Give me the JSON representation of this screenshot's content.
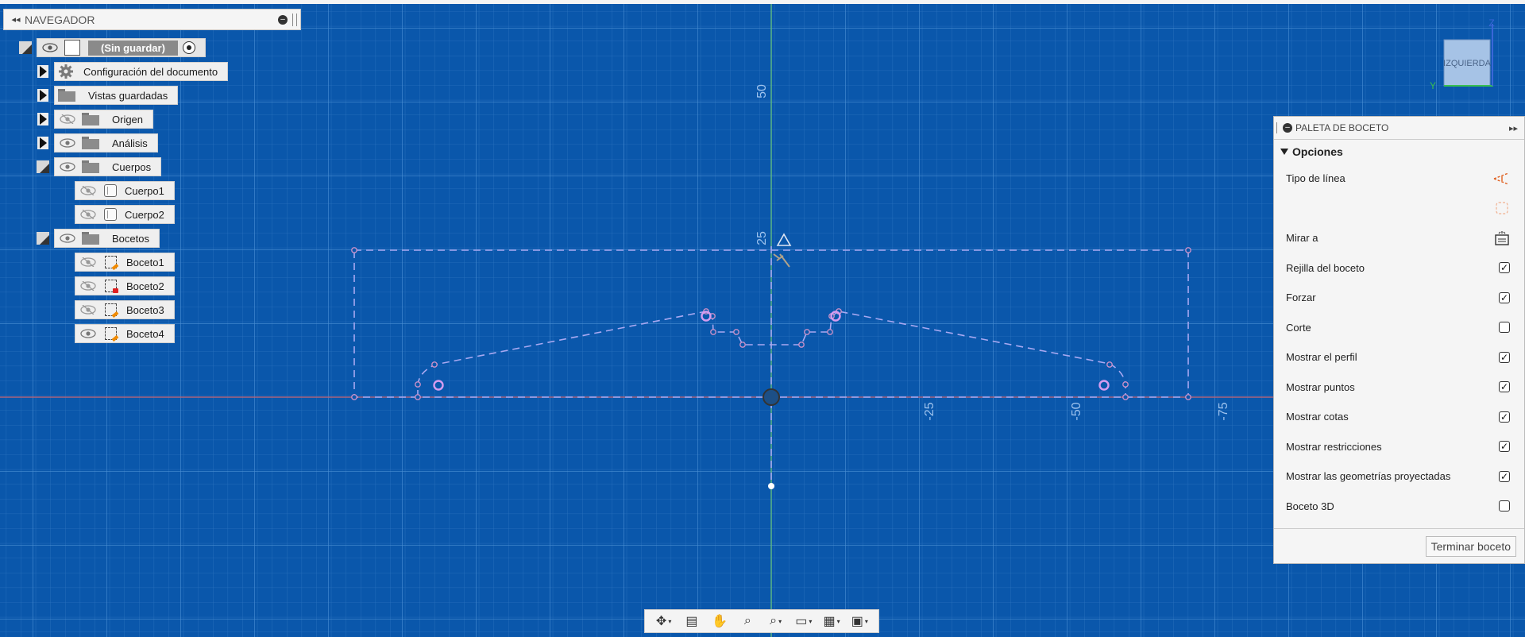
{
  "navigator": {
    "title": "NAVEGADOR",
    "root_label": "(Sin guardar)",
    "items": [
      {
        "label": "Configuración del documento"
      },
      {
        "label": "Vistas guardadas"
      },
      {
        "label": "Origen"
      },
      {
        "label": "Análisis"
      },
      {
        "label": "Cuerpos"
      },
      {
        "label": "Cuerpo1"
      },
      {
        "label": "Cuerpo2"
      },
      {
        "label": "Bocetos"
      },
      {
        "label": "Boceto1"
      },
      {
        "label": "Boceto2"
      },
      {
        "label": "Boceto3"
      },
      {
        "label": "Boceto4"
      }
    ]
  },
  "palette": {
    "title": "PALETA DE BOCETO",
    "section": "Opciones",
    "rows": [
      {
        "label": "Tipo de línea",
        "control": "linetype-icon"
      },
      {
        "label": "",
        "control": "construction-icon"
      },
      {
        "label": "Mirar a",
        "control": "look-at-icon"
      },
      {
        "label": "Rejilla del boceto",
        "checked": true
      },
      {
        "label": "Forzar",
        "checked": true
      },
      {
        "label": "Corte",
        "checked": false
      },
      {
        "label": "Mostrar el perfil",
        "checked": true
      },
      {
        "label": "Mostrar puntos",
        "checked": true
      },
      {
        "label": "Mostrar cotas",
        "checked": true
      },
      {
        "label": "Mostrar restricciones",
        "checked": true
      },
      {
        "label": "Mostrar las geometrías proyectadas",
        "checked": true
      },
      {
        "label": "Boceto 3D",
        "checked": false
      }
    ],
    "finish_label": "Terminar boceto"
  },
  "viewcube": {
    "face": "IZQUIERDA",
    "axis_z": "Z",
    "axis_y": "Y"
  },
  "axis_labels": {
    "v50": "50",
    "v25": "25",
    "h25": "-25",
    "h50": "-50",
    "h75": "-75"
  },
  "toolbar": {
    "items": [
      "orbit-icon",
      "look-at-icon",
      "pan-icon",
      "zoom-icon",
      "fit-icon",
      "display-settings-icon",
      "grid-icon",
      "viewports-icon"
    ]
  },
  "colors": {
    "background": "#0a57ab",
    "grid": "#3f83c9",
    "sketch": "#a9a9f2",
    "x_axis": "#c06070",
    "y_axis": "#62c07a"
  }
}
